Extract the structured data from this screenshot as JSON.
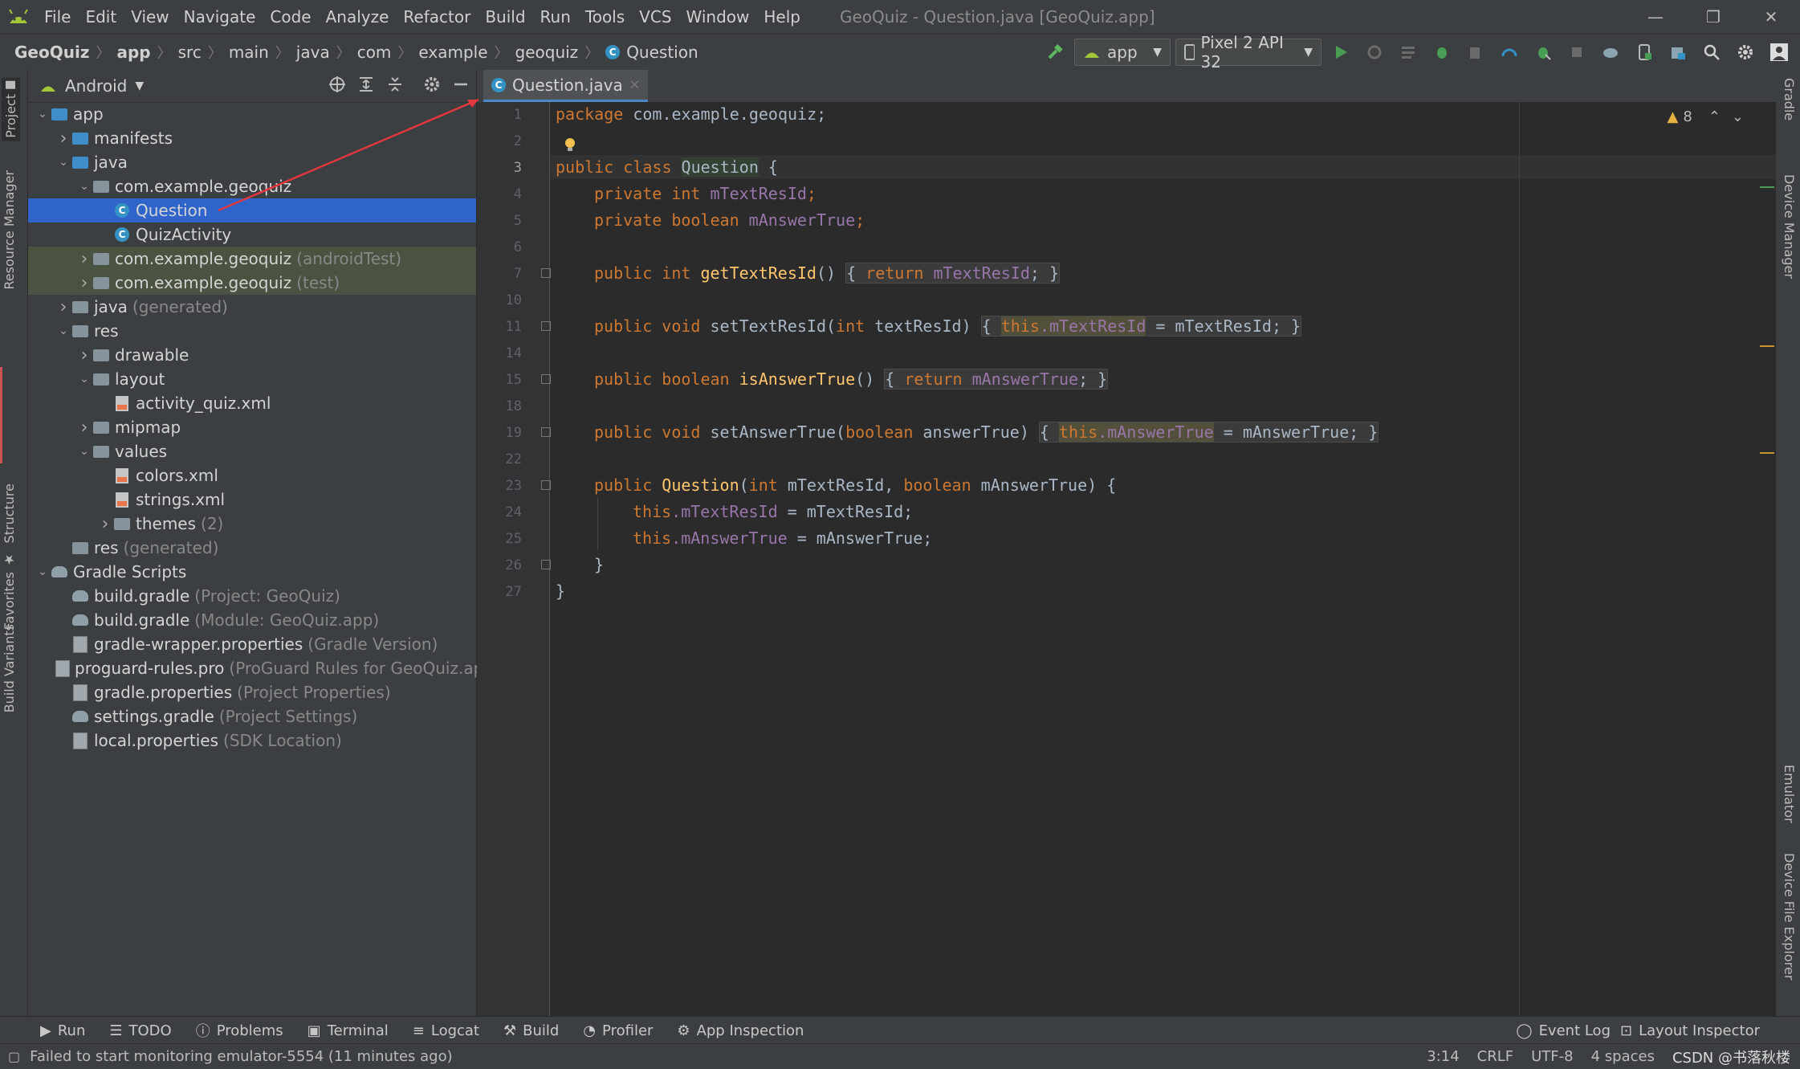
{
  "menubar": {
    "items": [
      "File",
      "Edit",
      "View",
      "Navigate",
      "Code",
      "Analyze",
      "Refactor",
      "Build",
      "Run",
      "Tools",
      "VCS",
      "Window",
      "Help"
    ],
    "title": "GeoQuiz - Question.java [GeoQuiz.app]"
  },
  "navbar": {
    "crumbs": [
      "GeoQuiz",
      "app",
      "src",
      "main",
      "java",
      "com",
      "example",
      "geoquiz",
      "Question"
    ],
    "run_config": "app",
    "device": "Pixel 2 API 32"
  },
  "left_stripe": {
    "project": "Project",
    "resource_manager": "Resource Manager",
    "structure": "Structure",
    "favorites": "Favorites",
    "build_variants": "Build Variants"
  },
  "right_stripe": {
    "gradle": "Gradle",
    "device_manager": "Device Manager",
    "emulator": "Emulator",
    "device_file_explorer": "Device File Explorer"
  },
  "project_panel": {
    "view": "Android",
    "tree": [
      {
        "label": "app",
        "hint": "",
        "depth": 0,
        "arrow": "v",
        "icon": "folder-blue"
      },
      {
        "label": "manifests",
        "hint": "",
        "depth": 1,
        "arrow": ">",
        "icon": "folder-blue"
      },
      {
        "label": "java",
        "hint": "",
        "depth": 1,
        "arrow": "v",
        "icon": "folder-blue"
      },
      {
        "label": "com.example.geoquiz",
        "hint": "",
        "depth": 2,
        "arrow": "v",
        "icon": "folder"
      },
      {
        "label": "Question",
        "hint": "",
        "depth": 3,
        "arrow": "",
        "icon": "class",
        "selected": true
      },
      {
        "label": "QuizActivity",
        "hint": "",
        "depth": 3,
        "arrow": "",
        "icon": "class"
      },
      {
        "label": "com.example.geoquiz",
        "hint": "(androidTest)",
        "depth": 2,
        "arrow": ">",
        "icon": "folder",
        "test": true
      },
      {
        "label": "com.example.geoquiz",
        "hint": "(test)",
        "depth": 2,
        "arrow": ">",
        "icon": "folder",
        "test": true
      },
      {
        "label": "java",
        "hint": "(generated)",
        "depth": 1,
        "arrow": ">",
        "icon": "folder"
      },
      {
        "label": "res",
        "hint": "",
        "depth": 1,
        "arrow": "v",
        "icon": "folder"
      },
      {
        "label": "drawable",
        "hint": "",
        "depth": 2,
        "arrow": ">",
        "icon": "folder"
      },
      {
        "label": "layout",
        "hint": "",
        "depth": 2,
        "arrow": "v",
        "icon": "folder"
      },
      {
        "label": "activity_quiz.xml",
        "hint": "",
        "depth": 3,
        "arrow": "",
        "icon": "xml"
      },
      {
        "label": "mipmap",
        "hint": "",
        "depth": 2,
        "arrow": ">",
        "icon": "folder"
      },
      {
        "label": "values",
        "hint": "",
        "depth": 2,
        "arrow": "v",
        "icon": "folder"
      },
      {
        "label": "colors.xml",
        "hint": "",
        "depth": 3,
        "arrow": "",
        "icon": "xml"
      },
      {
        "label": "strings.xml",
        "hint": "",
        "depth": 3,
        "arrow": "",
        "icon": "xml"
      },
      {
        "label": "themes",
        "hint": "(2)",
        "depth": 3,
        "arrow": ">",
        "icon": "folder"
      },
      {
        "label": "res",
        "hint": "(generated)",
        "depth": 1,
        "arrow": "",
        "icon": "folder"
      },
      {
        "label": "Gradle Scripts",
        "hint": "",
        "depth": 0,
        "arrow": "v",
        "icon": "gradle"
      },
      {
        "label": "build.gradle",
        "hint": "(Project: GeoQuiz)",
        "depth": 1,
        "arrow": "",
        "icon": "gradle"
      },
      {
        "label": "build.gradle",
        "hint": "(Module: GeoQuiz.app)",
        "depth": 1,
        "arrow": "",
        "icon": "gradle"
      },
      {
        "label": "gradle-wrapper.properties",
        "hint": "(Gradle Version)",
        "depth": 1,
        "arrow": "",
        "icon": "props"
      },
      {
        "label": "proguard-rules.pro",
        "hint": "(ProGuard Rules for GeoQuiz.app)",
        "depth": 1,
        "arrow": "",
        "icon": "props"
      },
      {
        "label": "gradle.properties",
        "hint": "(Project Properties)",
        "depth": 1,
        "arrow": "",
        "icon": "props"
      },
      {
        "label": "settings.gradle",
        "hint": "(Project Settings)",
        "depth": 1,
        "arrow": "",
        "icon": "gradle"
      },
      {
        "label": "local.properties",
        "hint": "(SDK Location)",
        "depth": 1,
        "arrow": "",
        "icon": "props"
      }
    ]
  },
  "editor": {
    "tab_label": "Question.java",
    "warnings": "8",
    "line_numbers": [
      "1",
      "2",
      "3",
      "4",
      "5",
      "6",
      "7",
      "10",
      "11",
      "14",
      "15",
      "18",
      "19",
      "22",
      "23",
      "24",
      "25",
      "26",
      "27"
    ],
    "code": {
      "l1_kw": "package ",
      "l1_rest": "com.example.geoquiz;",
      "l3_kw": "public class ",
      "l3_cls": "Question",
      "l3_rest": " {",
      "l4_kw": "private int ",
      "l4_fd": "mTextResId",
      "l4_rest": ";",
      "l5_kw": "private boolean ",
      "l5_fd": "mAnswerTrue",
      "l5_rest": ";",
      "l7_kw": "public int ",
      "l7_mt": "getTextResId",
      "l7_a": "() ",
      "l7_b": "{ ",
      "l7_kw2": "return ",
      "l7_fd": "mTextResId",
      "l7_c": "; }",
      "l11_kw": "public void ",
      "l11_mt": "setTextResId",
      "l11_a": "(",
      "l11_kw2": "int ",
      "l11_p": "textResId) ",
      "l11_b": "{ ",
      "l11_this": "this",
      "l11_fd": ".mTextResId",
      "l11_eq": " = ",
      "l11_p2": "mTextResId",
      "l11_c": "; }",
      "l15_kw": "public boolean ",
      "l15_mt": "isAnswerTrue",
      "l15_a": "() ",
      "l15_b": "{ ",
      "l15_kw2": "return ",
      "l15_fd": "mAnswerTrue",
      "l15_c": "; }",
      "l19_kw": "public void ",
      "l19_mt": "setAnswerTrue",
      "l19_a": "(",
      "l19_kw2": "boolean ",
      "l19_p": "answerTrue) ",
      "l19_b": "{ ",
      "l19_this": "this",
      "l19_fd": ".mAnswerTrue",
      "l19_eq": " = ",
      "l19_p2": "mAnswerTrue",
      "l19_c": "; }",
      "l23_kw": "public ",
      "l23_mt": "Question",
      "l23_a": "(",
      "l23_kw2": "int ",
      "l23_p1": "mTextResId, ",
      "l23_kw3": "boolean ",
      "l23_p2": "mAnswerTrue) {",
      "l24_kw": "this",
      "l24_fd": ".mTextResId",
      "l24_rest": " = mTextResId;",
      "l25_kw": "this",
      "l25_fd": ".mAnswerTrue",
      "l25_rest": " = mAnswerTrue;",
      "l26": "}",
      "l27": "}"
    }
  },
  "bottom_tools": {
    "run": "Run",
    "todo": "TODO",
    "problems": "Problems",
    "terminal": "Terminal",
    "logcat": "Logcat",
    "build": "Build",
    "profiler": "Profiler",
    "app_inspection": "App Inspection",
    "event_log": "Event Log",
    "layout_inspector": "Layout Inspector"
  },
  "status": {
    "message": "Failed to start monitoring emulator-5554 (11 minutes ago)",
    "position": "3:14",
    "line_sep": "CRLF",
    "encoding": "UTF-8",
    "indent": "4 spaces",
    "watermark": "CSDN @书落秋楼"
  },
  "colors": {
    "selection": "#2f65ca",
    "keyword": "#cc7832",
    "field": "#9876aa",
    "android_green": "#a4c639",
    "run_green": "#499c54"
  }
}
